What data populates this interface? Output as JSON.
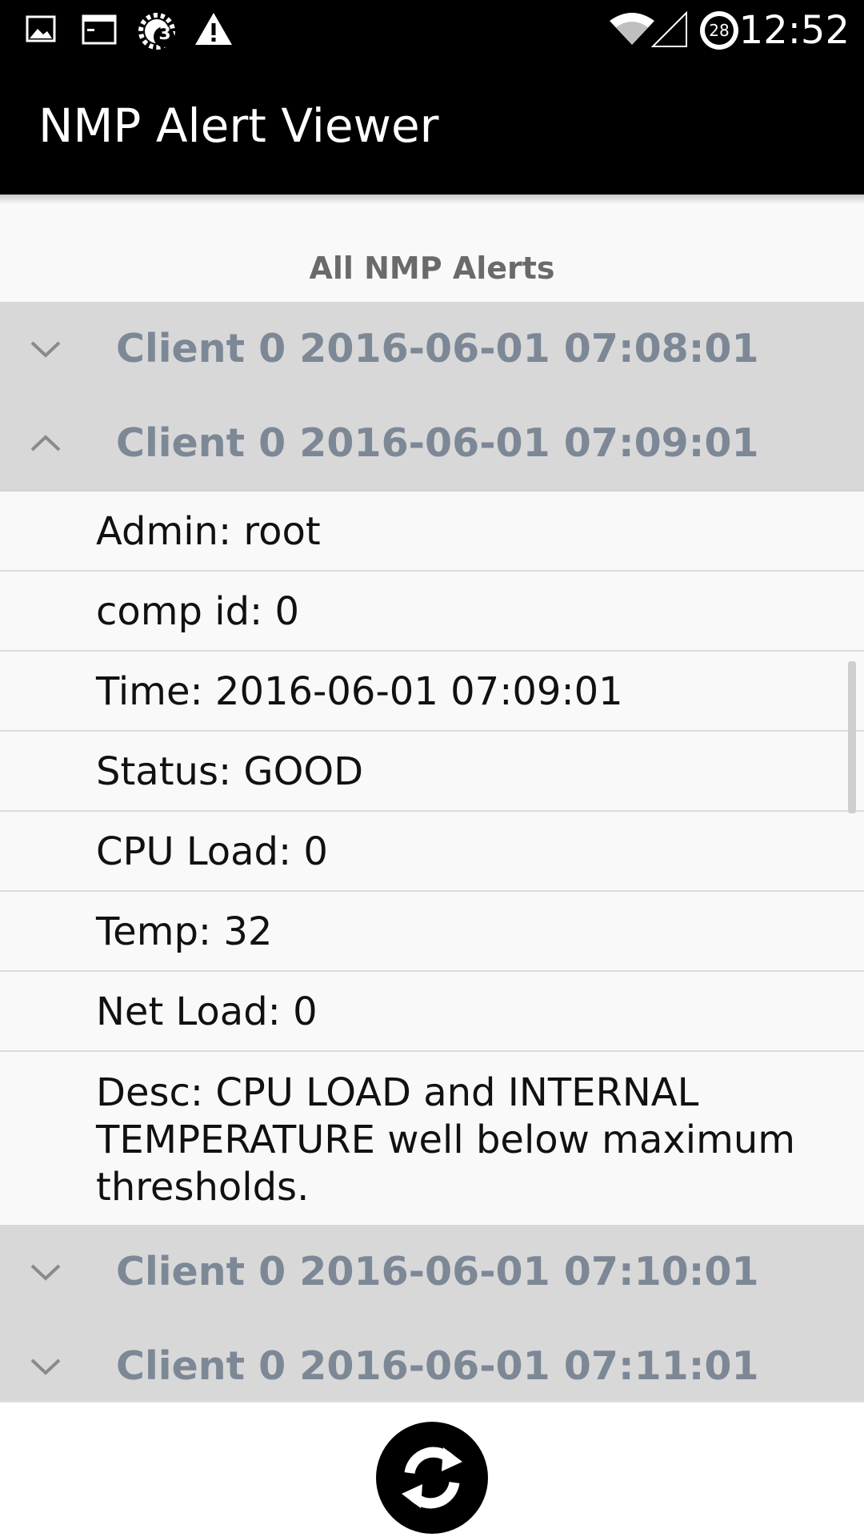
{
  "status_bar": {
    "icons": [
      "image-icon",
      "terminal-icon",
      "settings-badge-icon",
      "warning-icon",
      "wifi-icon",
      "signal-icon",
      "battery-icon"
    ],
    "settings_badge": "3",
    "battery_level": "28",
    "time": "12:52"
  },
  "app": {
    "title": "NMP Alert Viewer"
  },
  "list": {
    "header": "All NMP Alerts",
    "groups": [
      {
        "label": "Client 0 2016-06-01 07:08:01",
        "expanded": false
      },
      {
        "label": "Client 0 2016-06-01 07:09:01",
        "expanded": true
      },
      {
        "label": "Client 0 2016-06-01 07:10:01",
        "expanded": false
      },
      {
        "label": "Client 0 2016-06-01 07:11:01",
        "expanded": false
      }
    ],
    "details": [
      "Admin: root",
      "comp id: 0",
      "Time: 2016-06-01 07:09:01",
      "Status: GOOD",
      "CPU Load: 0",
      "Temp: 32",
      "Net Load: 0",
      "Desc: CPU LOAD and INTERNAL TEMPERATURE well below maximum thresholds."
    ]
  },
  "colors": {
    "bar_background": "#000000",
    "group_background": "#d8d8d8",
    "group_text": "#7d8896",
    "child_background": "#f9f9f9"
  },
  "actions": {
    "refresh_icon": "refresh-icon"
  }
}
